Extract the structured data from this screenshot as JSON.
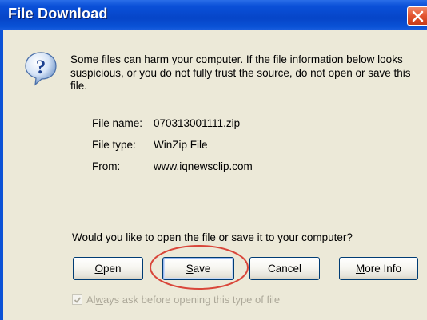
{
  "window": {
    "title": "File Download",
    "close_icon": "close-icon"
  },
  "message": {
    "icon": "question-icon",
    "warning": "Some files can harm your computer. If the file information below looks suspicious, or you do not fully trust the source, do not open or save this file."
  },
  "file_info": {
    "name_label": "File name:",
    "name_value": "070313001111.zip",
    "type_label": "File type:",
    "type_value": "WinZip File",
    "from_label": "From:",
    "from_value": "www.iqnewsclip.com"
  },
  "prompt": "Would you like to open the file or save it to your computer?",
  "buttons": {
    "open": {
      "mnemonic": "O",
      "rest": "pen"
    },
    "save": {
      "mnemonic": "S",
      "rest": "ave"
    },
    "cancel": "Cancel",
    "more_info": {
      "mnemonic": "M",
      "rest": "ore Info"
    }
  },
  "checkbox": {
    "checked": true,
    "pre": "Al",
    "mnemonic": "w",
    "rest": "ays ask before opening this type of file"
  },
  "colors": {
    "titlebar": "#0645c8",
    "body": "#ece9d8",
    "highlight_ellipse": "#d9463a",
    "close_button": "#e2532f"
  }
}
